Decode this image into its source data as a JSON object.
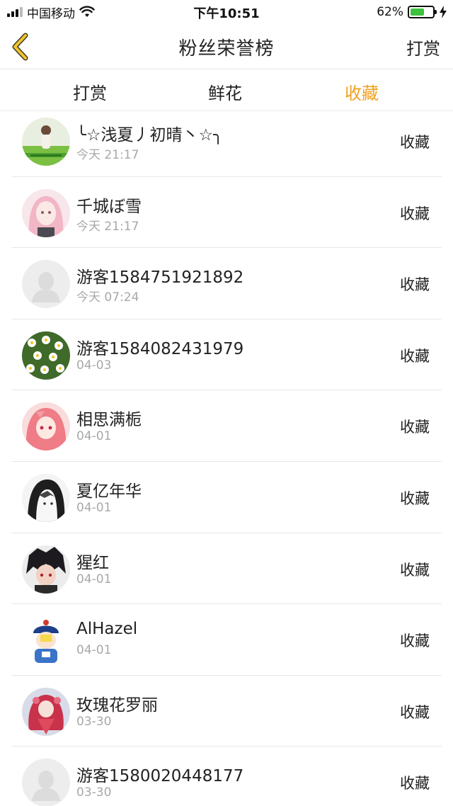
{
  "status_bar": {
    "carrier": "中国移动",
    "time": "下午10:51",
    "battery_percent": "62%",
    "battery_level": 0.62
  },
  "nav": {
    "title": "粉丝荣誉榜",
    "right_action": "打赏"
  },
  "tabs": [
    {
      "label": "打赏",
      "active": false
    },
    {
      "label": "鲜花",
      "active": false
    },
    {
      "label": "收藏",
      "active": true
    }
  ],
  "accent_color": "#f0a020",
  "list": [
    {
      "name": "╰☆浅夏丿初晴丶☆╮",
      "time": "今天 21:17",
      "action": "收藏",
      "avatar": "photo-girl-green"
    },
    {
      "name": "千城ぼ雪",
      "time": "今天 21:17",
      "action": "收藏",
      "avatar": "anime-pink-hair"
    },
    {
      "name": "游客1584751921892",
      "time": "今天 07:24",
      "action": "收藏",
      "avatar": "default-avatar"
    },
    {
      "name": "游客1584082431979",
      "time": "04-03",
      "action": "收藏",
      "avatar": "photo-daisies"
    },
    {
      "name": "相思满栀",
      "time": "04-01",
      "action": "收藏",
      "avatar": "anime-red-hair"
    },
    {
      "name": "夏亿年华",
      "time": "04-01",
      "action": "收藏",
      "avatar": "anime-hood-sketch"
    },
    {
      "name": "猩红",
      "time": "04-01",
      "action": "收藏",
      "avatar": "anime-dark-hair-boy"
    },
    {
      "name": "AlHazel",
      "time": "04-01",
      "action": "收藏",
      "avatar": "cartoon-qing-official"
    },
    {
      "name": "玫瑰花罗丽",
      "time": "03-30",
      "action": "收藏",
      "avatar": "anime-rose-girl"
    },
    {
      "name": "游客1580020448177",
      "time": "03-30",
      "action": "收藏",
      "avatar": "default-avatar"
    }
  ]
}
